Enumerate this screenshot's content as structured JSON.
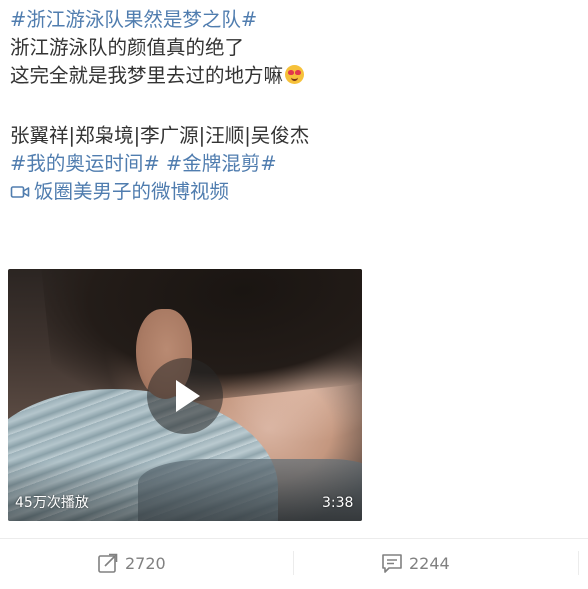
{
  "post": {
    "lines": [
      {
        "text": "#浙江游泳队果然是梦之队#",
        "kind": "hashtag"
      },
      {
        "text": "浙江游泳队的颜值真的绝了",
        "kind": "text"
      },
      {
        "text": "这完全就是我梦里去过的地方嘛",
        "kind": "text"
      },
      {
        "text": "张翼祥|郑枭境|李广源|汪顺|吴俊杰",
        "kind": "text"
      },
      {
        "text": "#我的奥运时间#",
        "kind": "hashtag"
      },
      {
        "text": "#金牌混剪#",
        "kind": "hashtag"
      },
      {
        "text": "饭圈美男子的微博视频",
        "kind": "video-link"
      }
    ],
    "emoji": "heart-eyes-emoji"
  },
  "video": {
    "views": "45万次播放",
    "duration": "3:38"
  },
  "footer": {
    "repost_count": "2720",
    "comment_count": "2244"
  },
  "colors": {
    "link": "#507daf",
    "text": "#333333",
    "muted": "#808080"
  }
}
